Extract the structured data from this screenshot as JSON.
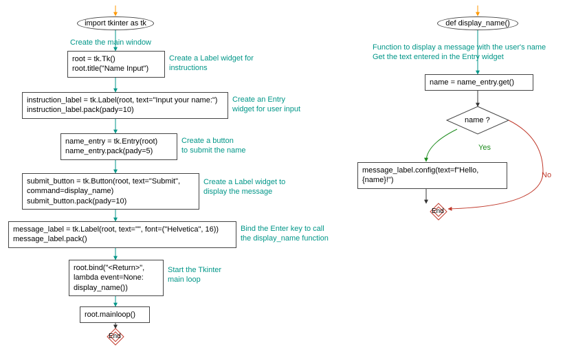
{
  "left": {
    "start": "import tkinter as tk",
    "a1": "Create the main window",
    "n1": "root = tk.Tk()\nroot.title(\"Name Input\")",
    "a2": "Create a Label widget for\ninstructions",
    "n2": "instruction_label = tk.Label(root, text=\"Input your name:\")\ninstruction_label.pack(pady=10)",
    "a3": "Create an Entry\nwidget for user input",
    "n3": "name_entry = tk.Entry(root)\nname_entry.pack(pady=5)",
    "a4": "Create a button\nto submit the name",
    "n4": "submit_button = tk.Button(root, text=\"Submit\",\ncommand=display_name)\nsubmit_button.pack(pady=10)",
    "a5": "Create a Label widget to\ndisplay the message",
    "n5": "message_label = tk.Label(root, text=\"\", font=(\"Helvetica\", 16))\nmessage_label.pack()",
    "a6": "Bind the Enter key to call\nthe display_name function",
    "n6": "root.bind(\"<Return>\",\nlambda event=None:\ndisplay_name())",
    "a7": "Start the Tkinter\nmain loop",
    "n7": "root.mainloop()",
    "end": "End"
  },
  "right": {
    "start": "def display_name()",
    "a1": "Function to display a message with the user's name\nGet the text entered in the Entry widget",
    "n1": "name = name_entry.get()",
    "decision": "name ?",
    "yes": "Yes",
    "no": "No",
    "n2": "message_label.config(text=f\"Hello,\n{name}!\")",
    "end": "End"
  }
}
